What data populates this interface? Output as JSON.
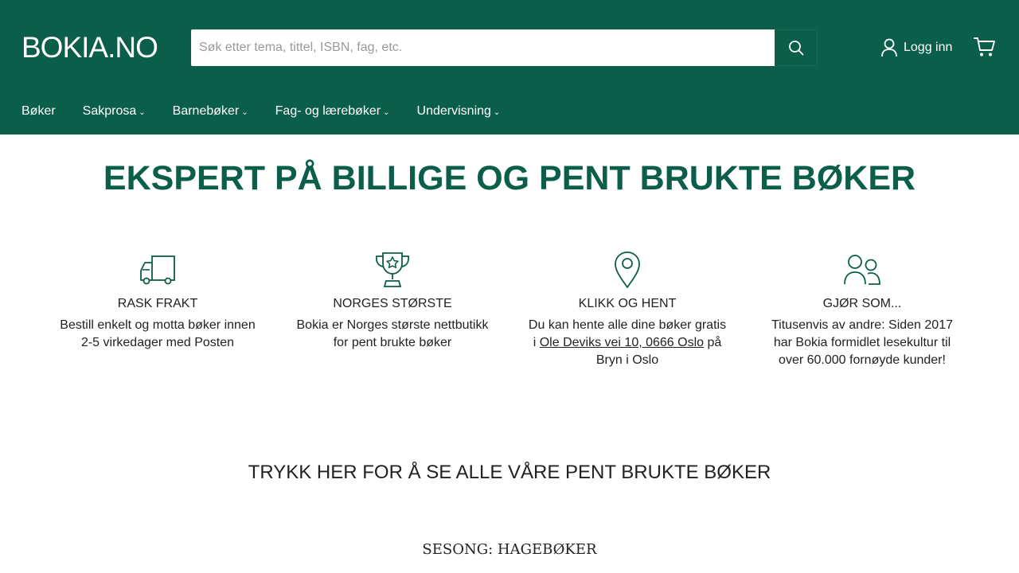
{
  "header": {
    "logo": "BOKIA.NO",
    "search_placeholder": "Søk etter tema, tittel, ISBN, fag, etc.",
    "login_label": "Logg inn",
    "colors": {
      "brand": "#0b5e49",
      "text_on_brand": "#ffffff"
    }
  },
  "nav": {
    "items": [
      {
        "label": "Bøker",
        "dropdown": false
      },
      {
        "label": "Sakprosa",
        "dropdown": true
      },
      {
        "label": "Barnebøker",
        "dropdown": true
      },
      {
        "label": "Fag- og lærebøker",
        "dropdown": true
      },
      {
        "label": "Undervisning",
        "dropdown": true
      }
    ]
  },
  "hero": {
    "title": "EKSPERT PÅ BILLIGE OG PENT BRUKTE BØKER"
  },
  "features": [
    {
      "icon": "truck-icon",
      "title": "RASK FRAKT",
      "text": "Bestill enkelt og motta bøker innen 2-5 virkedager med Posten"
    },
    {
      "icon": "trophy-icon",
      "title": "NORGES STØRSTE",
      "text": "Bokia er Norges største nettbutikk for pent brukte bøker"
    },
    {
      "icon": "map-pin-icon",
      "title": "KLIKK OG HENT",
      "text_before": "Du kan hente alle dine bøker gratis i",
      "link": "Ole Deviks vei 10, 0666 Oslo",
      "text_after": "på Bryn i Oslo"
    },
    {
      "icon": "users-icon",
      "title": "GJØR SOM...",
      "text": "Titusenvis av andre: Siden 2017 har Bokia formidlet lesekultur til over 60.000 fornøyde kunder!"
    }
  ],
  "cta": {
    "label": "TRYKK HER FOR Å SE ALLE VÅRE PENT BRUKTE BØKER"
  },
  "season": {
    "heading": "SESONG: HAGEBØKER"
  }
}
